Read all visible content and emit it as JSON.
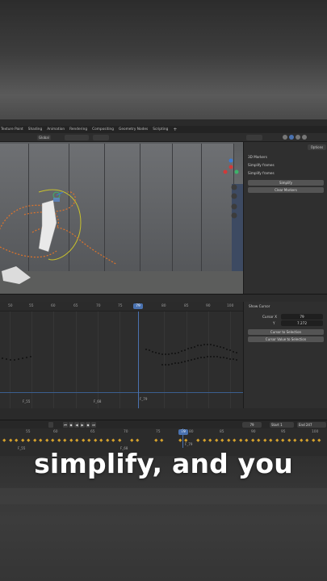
{
  "workspace_tabs": [
    "Texture Paint",
    "Shading",
    "Animation",
    "Rendering",
    "Compositing",
    "Geometry Nodes",
    "Scripting",
    "+"
  ],
  "viewport_header": {
    "orientation": "Global",
    "options_label": "Options"
  },
  "sidebar": {
    "panels": [
      "3D Markers",
      "Simplify frames",
      "Simplify frames"
    ],
    "buttons": [
      "Simplify",
      "Clear Markers"
    ]
  },
  "graph_editor": {
    "ruler_ticks": [
      "50",
      "55",
      "60",
      "65",
      "70",
      "75",
      "80",
      "85",
      "90",
      "95",
      "100"
    ],
    "current_frame": "79",
    "markers": [
      "F_55",
      "F_68",
      "F_79"
    ]
  },
  "cursor_panel": {
    "show_cursor_label": "Show Cursor",
    "cursor_x_label": "Cursor X",
    "cursor_x_value": "79",
    "y_label": "Y",
    "y_value": "7.272",
    "buttons": [
      "Cursor to Selection",
      "Cursor Value to Selection"
    ]
  },
  "playback": {
    "current_frame": "79",
    "start_label": "Start",
    "start_value": "1",
    "end_label": "End",
    "end_value": "247"
  },
  "timeline": {
    "ticks": [
      "55",
      "60",
      "65",
      "70",
      "75",
      "80",
      "85",
      "90",
      "95",
      "100"
    ],
    "current_frame": "79",
    "markers": [
      "F_55",
      "F_68",
      "F_79"
    ]
  },
  "caption": "simplify, and you",
  "colors": {
    "accent": "#4a72b0",
    "keyframe": "#d6a22c",
    "motion_path": "#e0742a"
  }
}
